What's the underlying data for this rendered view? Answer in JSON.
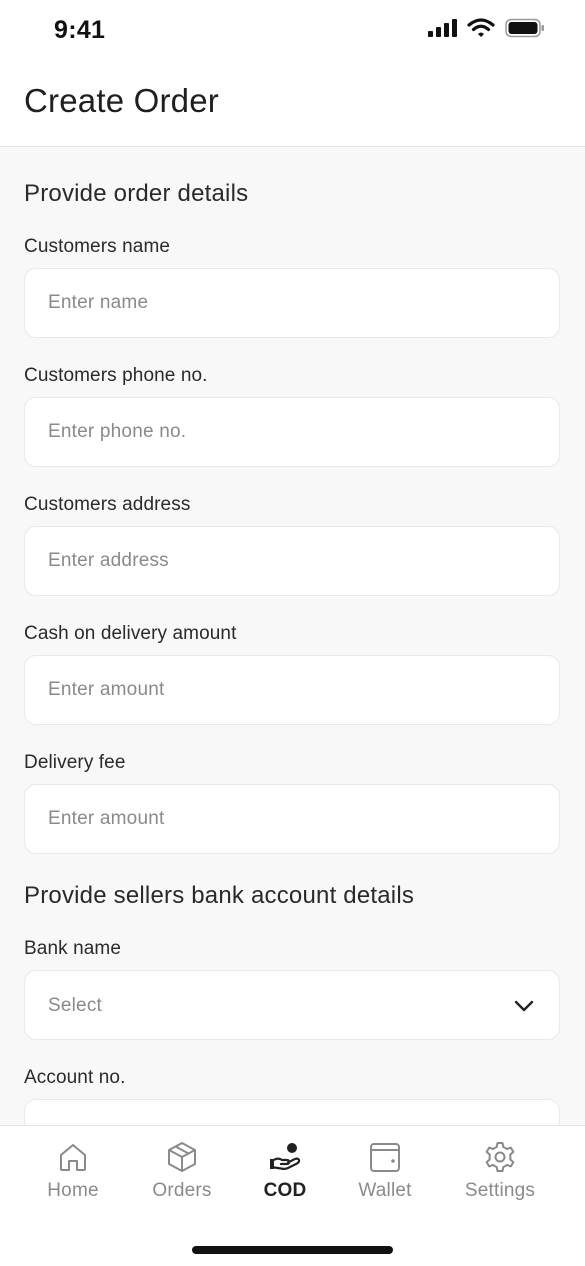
{
  "status_bar": {
    "time": "9:41"
  },
  "header": {
    "title": "Create Order"
  },
  "order_section": {
    "title": "Provide order details",
    "fields": [
      {
        "label": "Customers name",
        "placeholder": "Enter name",
        "value": ""
      },
      {
        "label": "Customers phone no.",
        "placeholder": "Enter phone no.",
        "value": ""
      },
      {
        "label": "Customers address",
        "placeholder": "Enter address",
        "value": ""
      },
      {
        "label": "Cash on delivery amount",
        "placeholder": "Enter amount",
        "value": ""
      },
      {
        "label": "Delivery fee",
        "placeholder": "Enter amount",
        "value": ""
      }
    ]
  },
  "bank_section": {
    "title": "Provide sellers bank account details",
    "bank_name": {
      "label": "Bank name",
      "selected": "Select"
    },
    "account_no": {
      "label": "Account no.",
      "placeholder": "",
      "value": ""
    }
  },
  "bottom_nav": {
    "items": [
      {
        "label": "Home",
        "icon": "home-icon",
        "active": false
      },
      {
        "label": "Orders",
        "icon": "box-icon",
        "active": false
      },
      {
        "label": "COD",
        "icon": "hand-coin-icon",
        "active": true
      },
      {
        "label": "Wallet",
        "icon": "wallet-icon",
        "active": false
      },
      {
        "label": "Settings",
        "icon": "gear-icon",
        "active": false
      }
    ]
  },
  "colors": {
    "background": "#f8f8f8",
    "surface": "#ffffff",
    "border": "#e9e9e9",
    "text": "#222222",
    "placeholder": "#8a8a8a",
    "inactive_nav": "#8a8a8a"
  }
}
